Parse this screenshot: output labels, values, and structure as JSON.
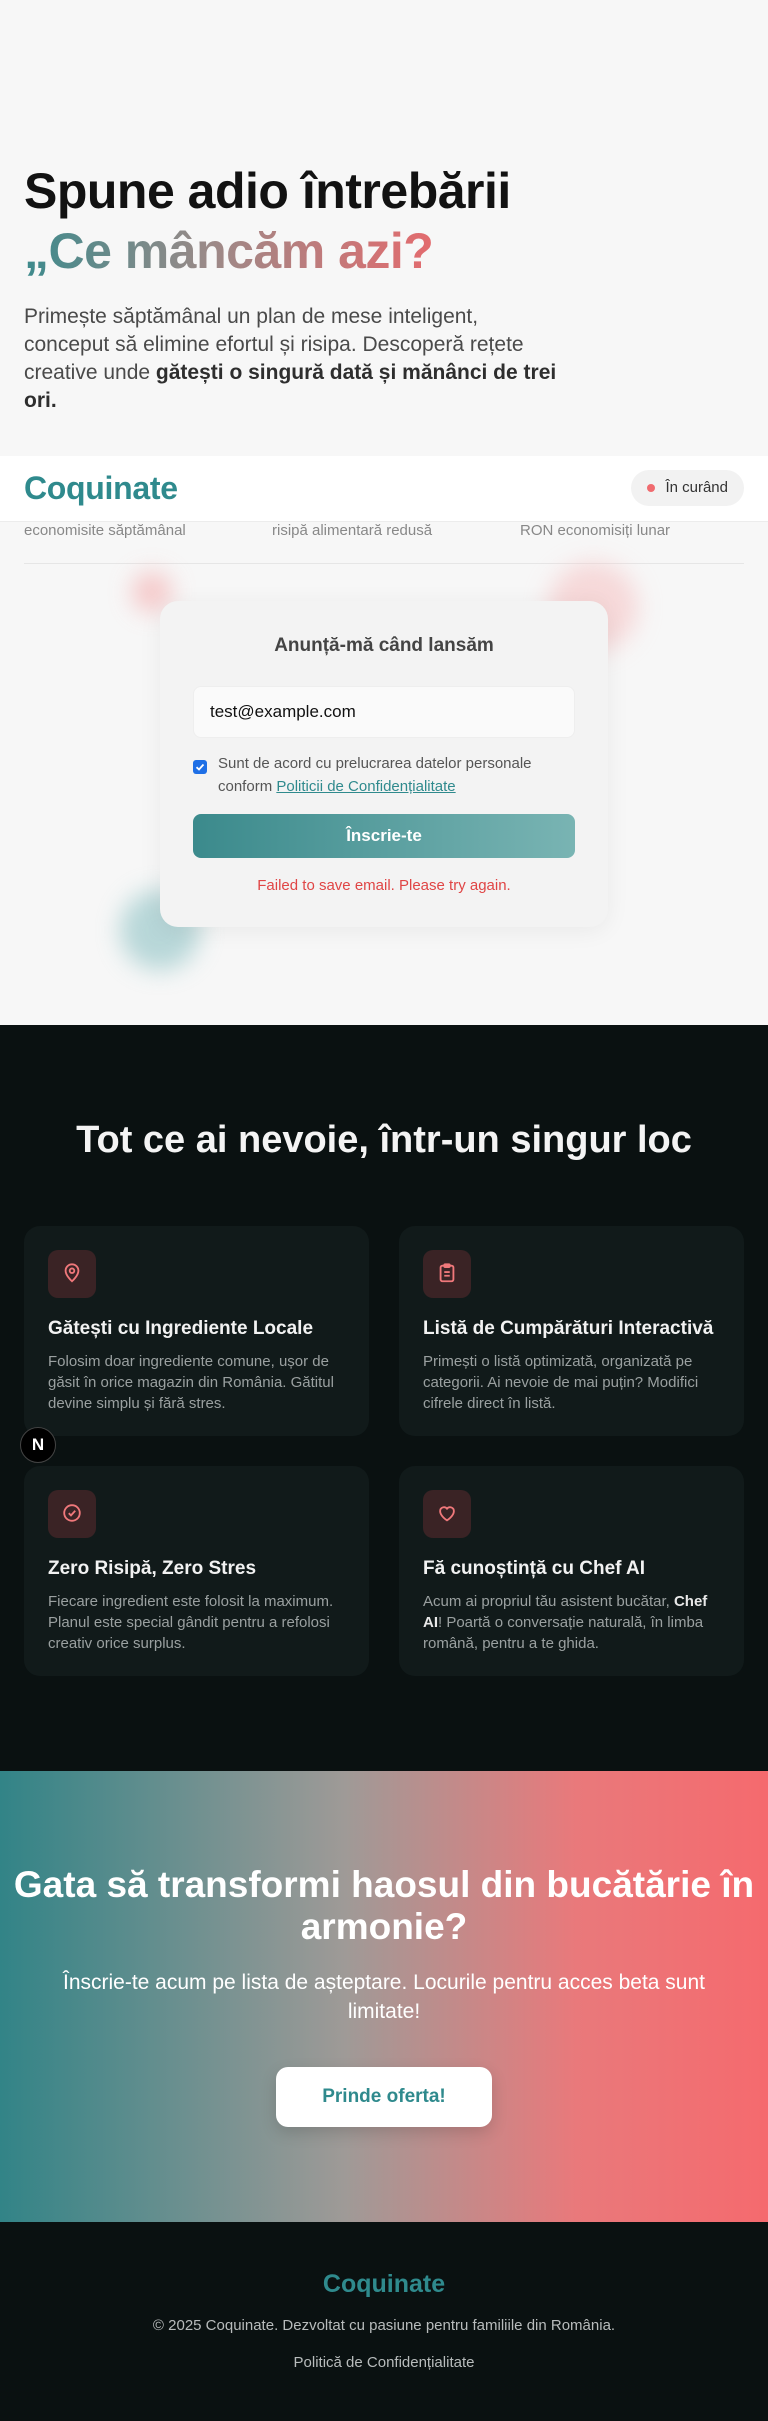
{
  "hero": {
    "title_line1": "Spune adio întrebării",
    "title_line2": "„Ce mâncăm azi?",
    "lede_text": "Primește săptămânal un plan de mese inteligent, conceput să elimine efortul și risipa. Descoperă rețete creative unde ",
    "lede_bold": "gătești o singură dată și mănânci de trei ori."
  },
  "navbar": {
    "logo": "Coquinate",
    "status_badge": "În curând"
  },
  "stats": [
    {
      "label": "economisite săptămânal"
    },
    {
      "label": "risipă alimentară redusă"
    },
    {
      "label": "RON economisiți lunar"
    }
  ],
  "signup": {
    "title": "Anunță-mă când lansăm",
    "email_value": "test@example.com",
    "consent_text": "Sunt de acord cu prelucrarea datelor personale conform ",
    "consent_link": "Politicii de Confidențialitate",
    "consent_checked": true,
    "submit_label": "Înscrie-te",
    "error_message": "Failed to save email. Please try again."
  },
  "features": {
    "title": "Tot ce ai nevoie, într-un singur loc",
    "items": [
      {
        "icon": "map-pin-icon",
        "name": "Gătești cu Ingrediente Locale",
        "desc": "Folosim doar ingrediente comune, ușor de găsit în orice magazin din România. Gătitul devine simplu și fără stres."
      },
      {
        "icon": "clipboard-list-icon",
        "name": "Listă de Cumpărături Interactivă",
        "desc": "Primești o listă optimizată, organizată pe categorii. Ai nevoie de mai puțin? Modifici cifrele direct în listă."
      },
      {
        "icon": "check-circle-icon",
        "name": "Zero Risipă, Zero Stres",
        "desc": "Fiecare ingredient este folosit la maximum. Planul este special gândit pentru a refolosi creativ orice surplus."
      },
      {
        "icon": "heart-icon",
        "name": "Fă cunoștință cu Chef AI",
        "desc_before": "Acum ai propriul tău asistent bucătar, ",
        "desc_bold": "Chef AI",
        "desc_after": "! Poartă o conversație naturală, în limba română, pentru a te ghida."
      }
    ]
  },
  "dev_badge": "N",
  "cta": {
    "title": "Gata să transformi haosul din bucătărie în armonie?",
    "subtitle": "Înscrie-te acum pe lista de așteptare. Locurile pentru acces beta sunt limitate!",
    "button_label": "Prinde oferta!"
  },
  "footer": {
    "logo": "Coquinate",
    "copyright": "© 2025 Coquinate. Dezvoltat cu pasiune pentru familiile din România.",
    "privacy_link": "Politică de Confidențialitate"
  },
  "colors": {
    "brand_teal": "#2f8a8d",
    "brand_coral": "#f06b6f",
    "dark_bg": "#0a1111",
    "error": "#e04545"
  }
}
